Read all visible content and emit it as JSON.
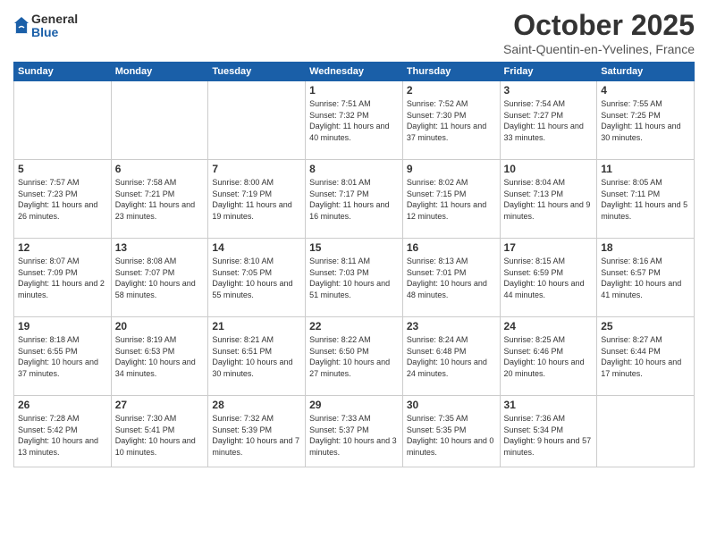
{
  "header": {
    "logo_general": "General",
    "logo_blue": "Blue",
    "month": "October 2025",
    "location": "Saint-Quentin-en-Yvelines, France"
  },
  "weekdays": [
    "Sunday",
    "Monday",
    "Tuesday",
    "Wednesday",
    "Thursday",
    "Friday",
    "Saturday"
  ],
  "weeks": [
    [
      {
        "day": "",
        "info": ""
      },
      {
        "day": "",
        "info": ""
      },
      {
        "day": "",
        "info": ""
      },
      {
        "day": "1",
        "info": "Sunrise: 7:51 AM\nSunset: 7:32 PM\nDaylight: 11 hours\nand 40 minutes."
      },
      {
        "day": "2",
        "info": "Sunrise: 7:52 AM\nSunset: 7:30 PM\nDaylight: 11 hours\nand 37 minutes."
      },
      {
        "day": "3",
        "info": "Sunrise: 7:54 AM\nSunset: 7:27 PM\nDaylight: 11 hours\nand 33 minutes."
      },
      {
        "day": "4",
        "info": "Sunrise: 7:55 AM\nSunset: 7:25 PM\nDaylight: 11 hours\nand 30 minutes."
      }
    ],
    [
      {
        "day": "5",
        "info": "Sunrise: 7:57 AM\nSunset: 7:23 PM\nDaylight: 11 hours\nand 26 minutes."
      },
      {
        "day": "6",
        "info": "Sunrise: 7:58 AM\nSunset: 7:21 PM\nDaylight: 11 hours\nand 23 minutes."
      },
      {
        "day": "7",
        "info": "Sunrise: 8:00 AM\nSunset: 7:19 PM\nDaylight: 11 hours\nand 19 minutes."
      },
      {
        "day": "8",
        "info": "Sunrise: 8:01 AM\nSunset: 7:17 PM\nDaylight: 11 hours\nand 16 minutes."
      },
      {
        "day": "9",
        "info": "Sunrise: 8:02 AM\nSunset: 7:15 PM\nDaylight: 11 hours\nand 12 minutes."
      },
      {
        "day": "10",
        "info": "Sunrise: 8:04 AM\nSunset: 7:13 PM\nDaylight: 11 hours\nand 9 minutes."
      },
      {
        "day": "11",
        "info": "Sunrise: 8:05 AM\nSunset: 7:11 PM\nDaylight: 11 hours\nand 5 minutes."
      }
    ],
    [
      {
        "day": "12",
        "info": "Sunrise: 8:07 AM\nSunset: 7:09 PM\nDaylight: 11 hours\nand 2 minutes."
      },
      {
        "day": "13",
        "info": "Sunrise: 8:08 AM\nSunset: 7:07 PM\nDaylight: 10 hours\nand 58 minutes."
      },
      {
        "day": "14",
        "info": "Sunrise: 8:10 AM\nSunset: 7:05 PM\nDaylight: 10 hours\nand 55 minutes."
      },
      {
        "day": "15",
        "info": "Sunrise: 8:11 AM\nSunset: 7:03 PM\nDaylight: 10 hours\nand 51 minutes."
      },
      {
        "day": "16",
        "info": "Sunrise: 8:13 AM\nSunset: 7:01 PM\nDaylight: 10 hours\nand 48 minutes."
      },
      {
        "day": "17",
        "info": "Sunrise: 8:15 AM\nSunset: 6:59 PM\nDaylight: 10 hours\nand 44 minutes."
      },
      {
        "day": "18",
        "info": "Sunrise: 8:16 AM\nSunset: 6:57 PM\nDaylight: 10 hours\nand 41 minutes."
      }
    ],
    [
      {
        "day": "19",
        "info": "Sunrise: 8:18 AM\nSunset: 6:55 PM\nDaylight: 10 hours\nand 37 minutes."
      },
      {
        "day": "20",
        "info": "Sunrise: 8:19 AM\nSunset: 6:53 PM\nDaylight: 10 hours\nand 34 minutes."
      },
      {
        "day": "21",
        "info": "Sunrise: 8:21 AM\nSunset: 6:51 PM\nDaylight: 10 hours\nand 30 minutes."
      },
      {
        "day": "22",
        "info": "Sunrise: 8:22 AM\nSunset: 6:50 PM\nDaylight: 10 hours\nand 27 minutes."
      },
      {
        "day": "23",
        "info": "Sunrise: 8:24 AM\nSunset: 6:48 PM\nDaylight: 10 hours\nand 24 minutes."
      },
      {
        "day": "24",
        "info": "Sunrise: 8:25 AM\nSunset: 6:46 PM\nDaylight: 10 hours\nand 20 minutes."
      },
      {
        "day": "25",
        "info": "Sunrise: 8:27 AM\nSunset: 6:44 PM\nDaylight: 10 hours\nand 17 minutes."
      }
    ],
    [
      {
        "day": "26",
        "info": "Sunrise: 7:28 AM\nSunset: 5:42 PM\nDaylight: 10 hours\nand 13 minutes."
      },
      {
        "day": "27",
        "info": "Sunrise: 7:30 AM\nSunset: 5:41 PM\nDaylight: 10 hours\nand 10 minutes."
      },
      {
        "day": "28",
        "info": "Sunrise: 7:32 AM\nSunset: 5:39 PM\nDaylight: 10 hours\nand 7 minutes."
      },
      {
        "day": "29",
        "info": "Sunrise: 7:33 AM\nSunset: 5:37 PM\nDaylight: 10 hours\nand 3 minutes."
      },
      {
        "day": "30",
        "info": "Sunrise: 7:35 AM\nSunset: 5:35 PM\nDaylight: 10 hours\nand 0 minutes."
      },
      {
        "day": "31",
        "info": "Sunrise: 7:36 AM\nSunset: 5:34 PM\nDaylight: 9 hours\nand 57 minutes."
      },
      {
        "day": "",
        "info": ""
      }
    ]
  ]
}
